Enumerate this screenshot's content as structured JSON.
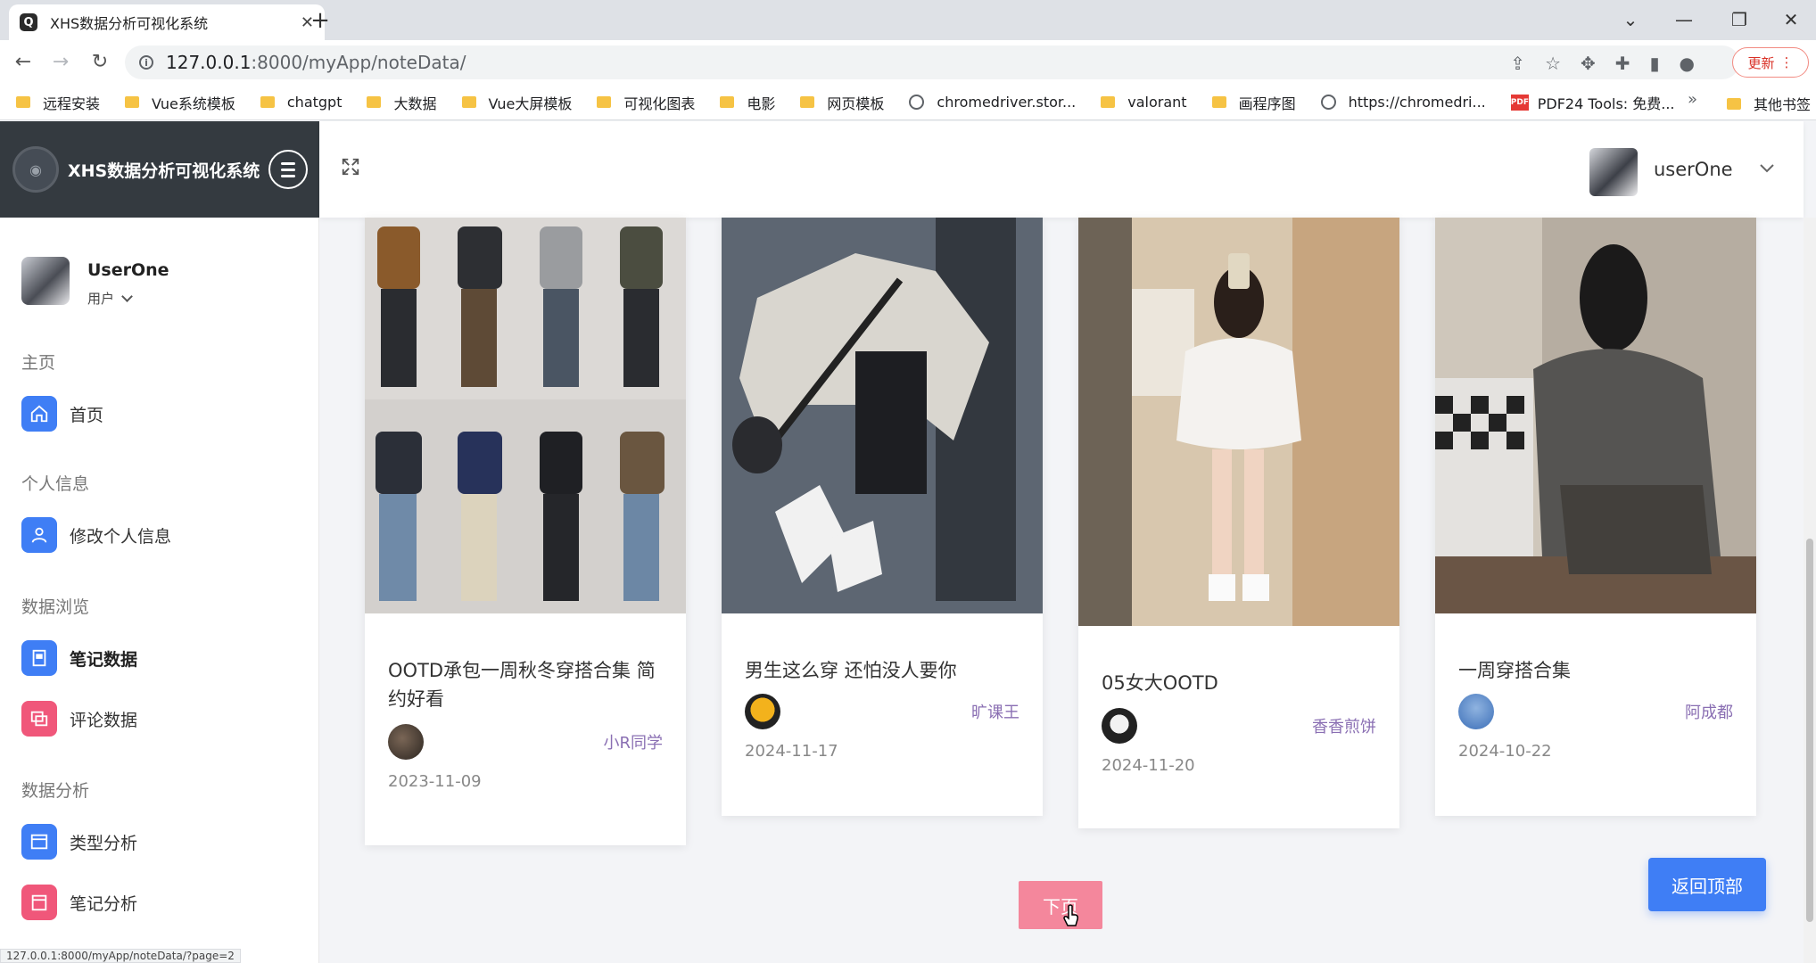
{
  "browser": {
    "tab_title": "XHS数据分析可视化系统",
    "tab_favicon": "Q",
    "url_host": "127.0.0.1",
    "url_rest": ":8000/myApp/noteData/",
    "update_label": "更新",
    "bookmarks": [
      "远程安装",
      "Vue系统模板",
      "chatgpt",
      "大数据",
      "Vue大屏模板",
      "可视化图表",
      "电影",
      "网页模板",
      "chromedriver.stor...",
      "valorant",
      "画程序图",
      "https://chromedri...",
      "PDF24 Tools: 免费..."
    ],
    "bookmarks_more": "»",
    "bookmarks_other": "其他书签",
    "status_url": "127.0.0.1:8000/myApp/noteData/?page=2"
  },
  "app": {
    "title": "XHS数据分析可视化系统"
  },
  "sidebar": {
    "user_name": "UserOne",
    "user_role": "用户",
    "sections": [
      {
        "label": "主页",
        "items": [
          {
            "label": "首页",
            "icon": "home-icon"
          }
        ]
      },
      {
        "label": "个人信息",
        "items": [
          {
            "label": "修改个人信息",
            "icon": "user-icon"
          }
        ]
      },
      {
        "label": "数据浏览",
        "items": [
          {
            "label": "笔记数据",
            "icon": "note-icon"
          },
          {
            "label": "评论数据",
            "icon": "comment-icon"
          }
        ]
      },
      {
        "label": "数据分析",
        "items": [
          {
            "label": "类型分析",
            "icon": "window-icon"
          },
          {
            "label": "笔记分析",
            "icon": "calendar-icon"
          }
        ]
      }
    ]
  },
  "header": {
    "username": "userOne"
  },
  "cards": [
    {
      "title": "OOTD承包一周秋冬穿搭合集 简约好看",
      "author": "小R同学",
      "date": "2023-11-09"
    },
    {
      "title": "男生这么穿 还怕没人要你",
      "author": "旷课王",
      "date": "2024-11-17"
    },
    {
      "title": "05女大OOTD",
      "author": "香香煎饼",
      "date": "2024-11-20"
    },
    {
      "title": "一周穿搭合集",
      "author": "阿成都",
      "date": "2024-10-22"
    }
  ],
  "pagination": {
    "next_label": "下页"
  },
  "back_to_top_label": "返回顶部",
  "colors": {
    "sidebar_header": "#343a40",
    "accent_blue": "#3f7ef5",
    "accent_pink": "#f0577a",
    "next_button": "#f4879c",
    "author_name": "#8a6fb3"
  }
}
